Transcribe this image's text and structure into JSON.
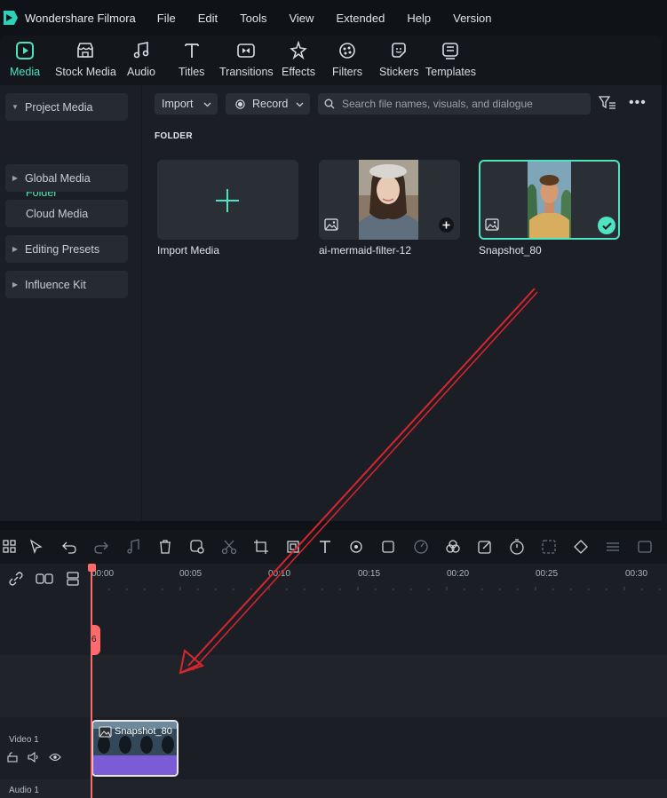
{
  "app": {
    "title": "Wondershare Filmora"
  },
  "menu": [
    "File",
    "Edit",
    "Tools",
    "View",
    "Extended",
    "Help",
    "Version"
  ],
  "toolbar": [
    "Media",
    "Stock Media",
    "Audio",
    "Titles",
    "Transitions",
    "Effects",
    "Filters",
    "Stickers",
    "Templates"
  ],
  "sidebar": {
    "project_media": "Project Media",
    "folder": "Folder",
    "global_media": "Global Media",
    "cloud_media": "Cloud Media",
    "editing_presets": "Editing Presets",
    "influence_kit": "Influence Kit"
  },
  "content": {
    "import_label": "Import",
    "record_label": "Record",
    "search_placeholder": "Search file names, visuals, and dialogue",
    "folder_label": "FOLDER",
    "cards": [
      "Import Media",
      "ai-mermaid-filter-12",
      "Snapshot_80"
    ]
  },
  "timeline": {
    "ruler": [
      "00:00",
      "00:05",
      "00:10",
      "00:15",
      "00:20",
      "00:25",
      "00:30"
    ],
    "video_track": "Video 1",
    "audio_track": "Audio 1",
    "clip_label": "Snapshot_80"
  },
  "colors": {
    "accent": "#4ee3c1",
    "playhead": "#ff6b6b",
    "arrow": "#d9252f",
    "clip": "#7c5cd6"
  }
}
